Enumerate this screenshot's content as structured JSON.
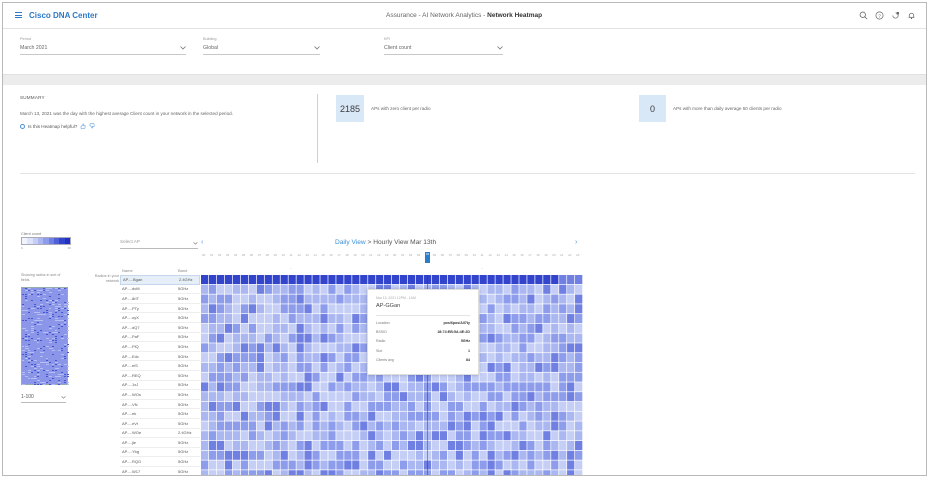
{
  "header": {
    "brand_name": "Cisco DNA Center",
    "breadcrumb_prefix": "Assurance - AI Network Analytics -",
    "breadcrumb_current": "Network Heatmap",
    "icons": [
      "search-icon",
      "help-icon",
      "notification-icon",
      "bell-icon"
    ]
  },
  "filters": {
    "period": {
      "label": "Period",
      "value": "March 2021"
    },
    "building": {
      "label": "Building",
      "value": "Global"
    },
    "kpi": {
      "label": "KPI",
      "value": "Client count"
    }
  },
  "summary": {
    "title": "SUMMARY",
    "text": "March 13, 2021 was the day with the highest average Client count in your network in the selected period.",
    "helpful": "Is this Heatmap helpful?",
    "kpi1": {
      "value": "2185",
      "text": "APs with zero client per radio"
    },
    "kpi2": {
      "value": "0",
      "text": "APs with more than daily average 50 clients per radio"
    }
  },
  "legend": {
    "title": "Client count",
    "min": "0",
    "max": "60",
    "colors": [
      "#f2f4fd",
      "#dde3fa",
      "#c5cff6",
      "#aab7f1",
      "#8d9ceb",
      "#6f7fe2",
      "#5061d8",
      "#3244cc",
      "#1f32c4"
    ]
  },
  "minimap": {
    "caption": "Showing radios in sort of fields"
  },
  "pager": {
    "value": "1-100"
  },
  "select_ap": {
    "placeholder": "Select AP"
  },
  "view": {
    "daily_link": "Daily View",
    "separator": ">",
    "hourly_title": "Hourly View Mar 13th"
  },
  "table": {
    "reason_text": "Radios in your network",
    "col_name": "Name",
    "col_band": "Band",
    "rows": [
      {
        "name": "AP-...Bgan",
        "band": "2.4GHz"
      },
      {
        "name": "AP-...dvM",
        "band": "5GHz"
      },
      {
        "name": "AP-...8rIT",
        "band": "5GHz"
      },
      {
        "name": "AP-...PTy",
        "band": "5GHz"
      },
      {
        "name": "AP-...oyX",
        "band": "5GHz"
      },
      {
        "name": "AP-...dQ7",
        "band": "5GHz"
      },
      {
        "name": "AP-...PaF",
        "band": "5GHz"
      },
      {
        "name": "AP-...FfQ",
        "band": "5GHz"
      },
      {
        "name": "AP-...Edc",
        "band": "5GHz"
      },
      {
        "name": "AP-...eiS",
        "band": "5GHz"
      },
      {
        "name": "AP-...REQ",
        "band": "5GHz"
      },
      {
        "name": "AP-...1xJ",
        "band": "5GHz"
      },
      {
        "name": "AP-...WOs",
        "band": "5GHz"
      },
      {
        "name": "AP-...VN",
        "band": "5GHz"
      },
      {
        "name": "AP-...ek",
        "band": "5GHz"
      },
      {
        "name": "AP-...eVr",
        "band": "5GHz"
      },
      {
        "name": "AP-...WOe",
        "band": "2.4GHz"
      },
      {
        "name": "AP-...jle",
        "band": "5GHz"
      },
      {
        "name": "AP-...Ybg",
        "band": "5GHz"
      },
      {
        "name": "AP-...RQG",
        "band": "5GHz"
      },
      {
        "name": "AP-...W17",
        "band": "5GHz"
      }
    ]
  },
  "hour_ticks": [
    "00",
    "01",
    "02",
    "03",
    "04",
    "05",
    "06",
    "07",
    "08",
    "09",
    "10",
    "11",
    "12",
    "13",
    "14",
    "15",
    "16",
    "17",
    "18",
    "19",
    "20",
    "21",
    "22",
    "23",
    "00",
    "01",
    "02",
    "03",
    "04",
    "05",
    "06",
    "07",
    "08",
    "09",
    "10",
    "11",
    "12",
    "13",
    "14",
    "15",
    "16",
    "17",
    "18",
    "19",
    "20",
    "21",
    "22",
    "23"
  ],
  "tooltip": {
    "timestamp": "Mar 13, 2021 12PM - 1AM",
    "ap_name": "AP-GGan",
    "rows": [
      {
        "label": "Location",
        "value": "pos/6pos/All7ty"
      },
      {
        "label": "BSSID",
        "value": "28:74:EB:5A:4E:2D"
      },
      {
        "label": "Radio",
        "value": "5GHz"
      },
      {
        "label": "Slot",
        "value": "1"
      },
      {
        "label": "Clients avg",
        "value": "84"
      }
    ]
  }
}
